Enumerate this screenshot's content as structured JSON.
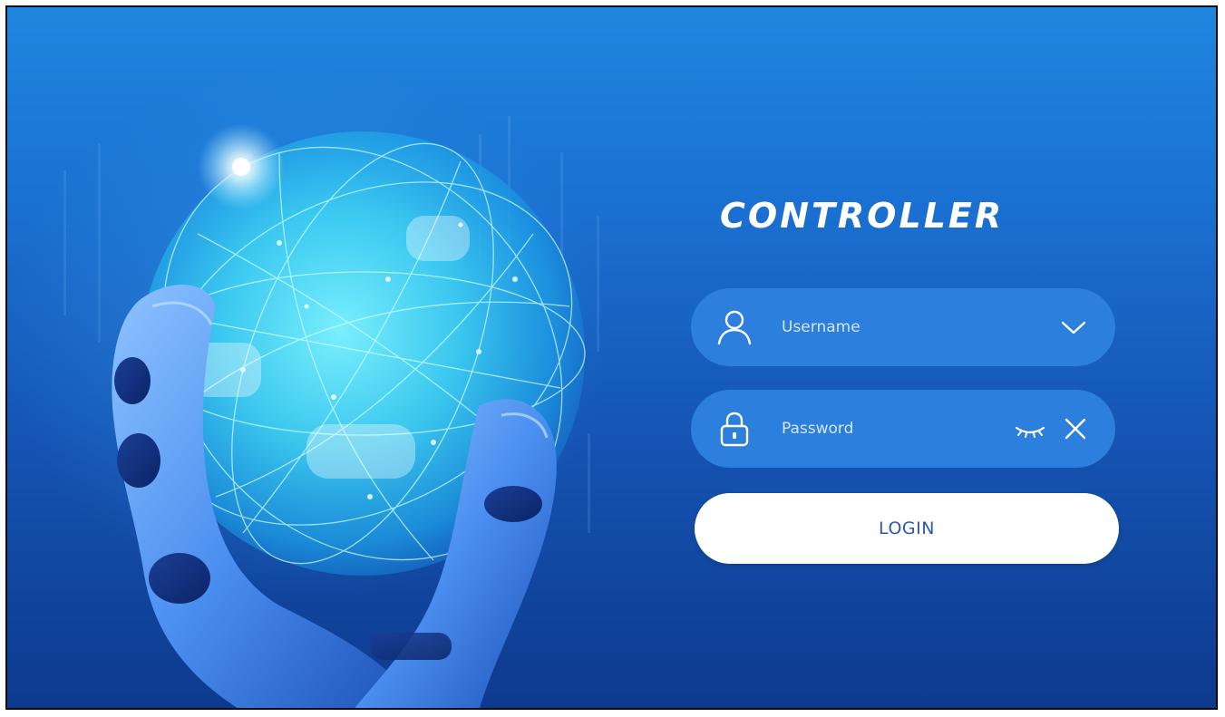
{
  "app": {
    "brand_title": "CONTROLLER"
  },
  "login_form": {
    "username": {
      "placeholder": "Username",
      "value": "",
      "lead_icon": "user-icon",
      "trail_icon": "chevron-down-icon"
    },
    "password": {
      "placeholder": "Password",
      "value": "",
      "lead_icon": "lock-icon",
      "trail_icons": [
        "eye-closed-icon",
        "close-icon"
      ]
    },
    "login_label": "LOGIN"
  },
  "colors": {
    "background_top": "#1f86e0",
    "background_bottom": "#0d3a8e",
    "field_fill": "#2c7fdc",
    "button_fill": "#ffffff",
    "button_text": "#2a5aa8",
    "globe_glow": "#5fe8ff"
  }
}
